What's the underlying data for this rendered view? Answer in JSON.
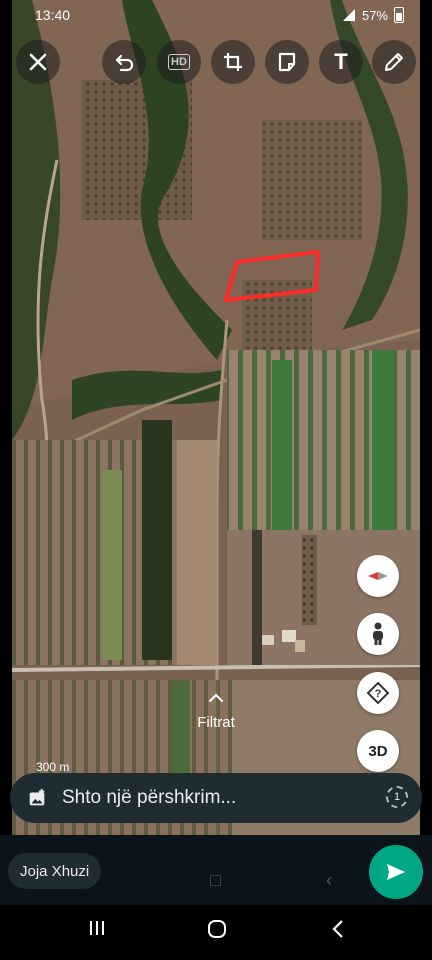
{
  "status_bar": {
    "time": "13:40",
    "battery": "57%",
    "battery_level": 0.57
  },
  "toolbar": {
    "close_icon": "close-icon",
    "undo_icon": "undo-icon",
    "hd_label": "HD",
    "crop_icon": "crop-rotate-icon",
    "sticker_icon": "sticker-icon",
    "text_label": "T",
    "draw_icon": "pencil-icon"
  },
  "map_controls": {
    "compass_icon": "compass-icon",
    "streetview_icon": "pegman-icon",
    "help_icon": "help-icon",
    "threed_label": "3D"
  },
  "filters": {
    "label": "Filtrat"
  },
  "scale": {
    "label": "300 m"
  },
  "caption": {
    "placeholder": "Shto një përshkrim..."
  },
  "recipient": {
    "name": "Joja Xhuzi"
  },
  "colors": {
    "accent": "#00a884",
    "panel": "#1f2c33",
    "marker": "#ff2a2a"
  }
}
